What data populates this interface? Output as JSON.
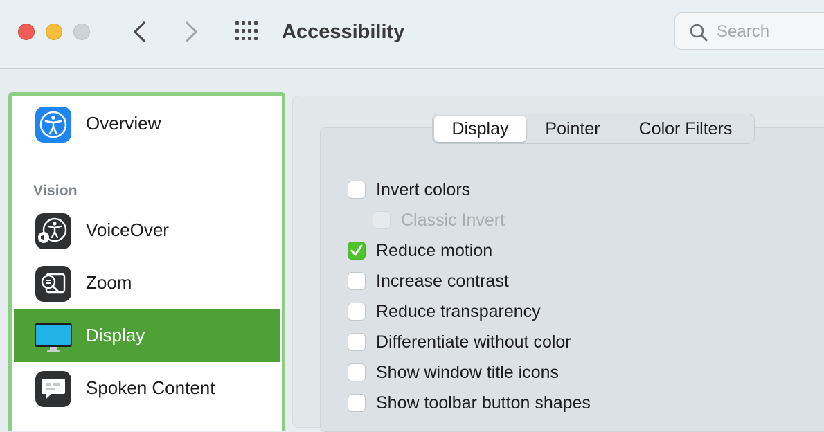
{
  "window": {
    "title": "Accessibility",
    "traffic_lights": [
      "close",
      "minimize",
      "zoom"
    ],
    "nav": {
      "back_icon": "chevron-left-icon",
      "forward_icon": "chevron-right-icon",
      "show_all_icon": "grid-icon"
    }
  },
  "search": {
    "placeholder": "Search",
    "value": ""
  },
  "sidebar": {
    "top_item": {
      "label": "Overview",
      "icon": "accessibility-icon"
    },
    "section_vision": "Vision",
    "items": [
      {
        "label": "VoiceOver",
        "icon": "voiceover-icon",
        "selected": false
      },
      {
        "label": "Zoom",
        "icon": "zoom-icon",
        "selected": false
      },
      {
        "label": "Display",
        "icon": "display-icon",
        "selected": true
      },
      {
        "label": "Spoken Content",
        "icon": "speech-bubble-icon",
        "selected": false
      }
    ]
  },
  "tabs": [
    {
      "label": "Display",
      "active": true
    },
    {
      "label": "Pointer",
      "active": false
    },
    {
      "label": "Color Filters",
      "active": false
    }
  ],
  "options": [
    {
      "label": "Invert colors",
      "checked": false,
      "enabled": true
    },
    {
      "label": "Classic Invert",
      "checked": false,
      "enabled": false
    },
    {
      "label": "Reduce motion",
      "checked": true,
      "enabled": true
    },
    {
      "label": "Increase contrast",
      "checked": false,
      "enabled": true
    },
    {
      "label": "Reduce transparency",
      "checked": false,
      "enabled": true
    },
    {
      "label": "Differentiate without color",
      "checked": false,
      "enabled": true
    },
    {
      "label": "Show window title icons",
      "checked": false,
      "enabled": true
    },
    {
      "label": "Show toolbar button shapes",
      "checked": false,
      "enabled": true
    }
  ],
  "colors": {
    "selection": "#4ea136",
    "sidebar_border": "#8ccf84",
    "checkbox_checked": "#4ec12b",
    "close": "#ed5c56",
    "minimize": "#f6be3b",
    "zoom_disabled": "#cdd3d6"
  }
}
